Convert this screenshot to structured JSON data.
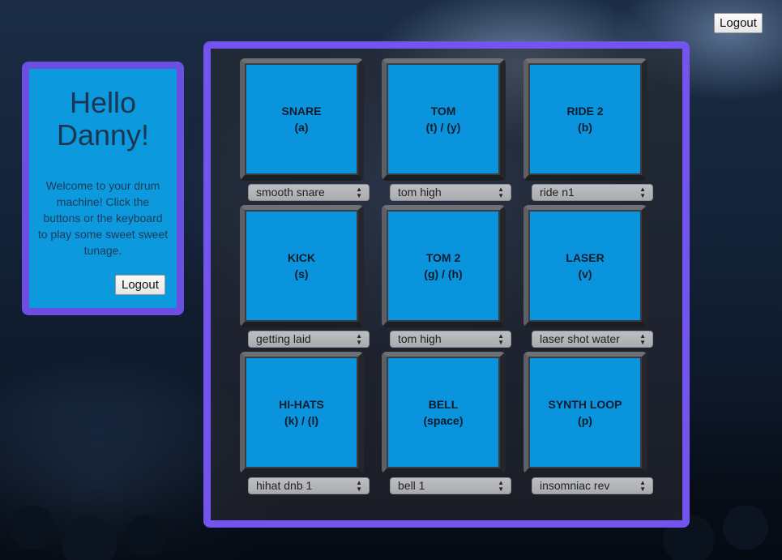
{
  "header": {
    "logout_label": "Logout"
  },
  "welcome": {
    "title": "Hello Danny!",
    "message": "Welcome to your drum machine! Click the buttons or the keyboard to play some sweet sweet tunage.",
    "logout_label": "Logout"
  },
  "pads": [
    {
      "name": "SNARE",
      "keys": "(a)",
      "sound": "smooth snare"
    },
    {
      "name": "TOM",
      "keys": "(t) / (y)",
      "sound": "tom high"
    },
    {
      "name": "RIDE 2",
      "keys": "(b)",
      "sound": "ride n1"
    },
    {
      "name": "KICK",
      "keys": "(s)",
      "sound": "getting laid"
    },
    {
      "name": "TOM 2",
      "keys": "(g) / (h)",
      "sound": "tom high"
    },
    {
      "name": "LASER",
      "keys": "(v)",
      "sound": "laser shot water"
    },
    {
      "name": "HI-HATS",
      "keys": "(k) / (l)",
      "sound": "hihat dnb 1"
    },
    {
      "name": "BELL",
      "keys": "(space)",
      "sound": "bell 1"
    },
    {
      "name": "SYNTH LOOP",
      "keys": "(p)",
      "sound": "insomniac rev"
    }
  ],
  "colors": {
    "accent": "#7454ee",
    "pad": "#0a94de",
    "panel": "#0c99de"
  }
}
